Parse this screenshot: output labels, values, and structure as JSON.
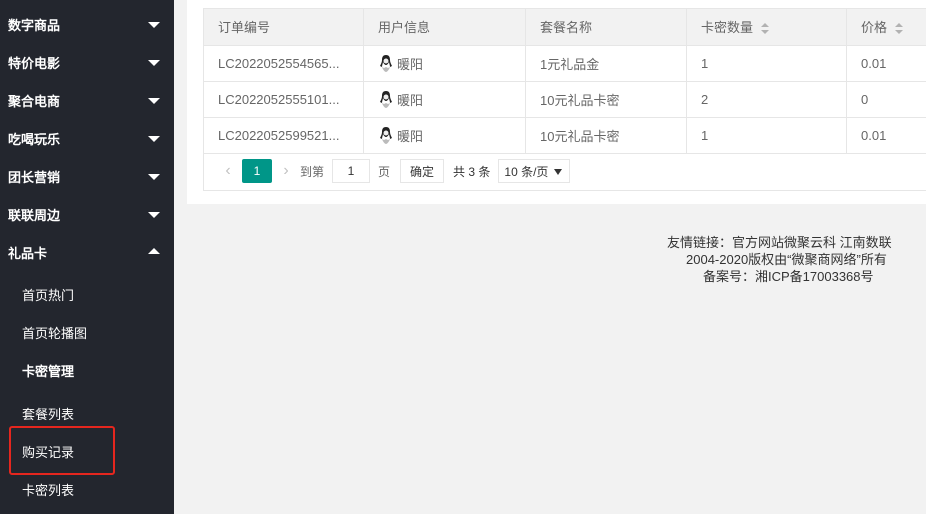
{
  "sidebar": {
    "groups": [
      {
        "label": "数字商品",
        "expanded": false
      },
      {
        "label": "特价电影",
        "expanded": false
      },
      {
        "label": "聚合电商",
        "expanded": false
      },
      {
        "label": "吃喝玩乐",
        "expanded": false
      },
      {
        "label": "团长营销",
        "expanded": false
      },
      {
        "label": "联联周边",
        "expanded": false
      },
      {
        "label": "礼品卡",
        "expanded": true
      }
    ],
    "sub_items": {
      "home_hot": "首页热门",
      "home_carousel": "首页轮播图",
      "card_management": "卡密管理",
      "package_list": "套餐列表",
      "purchase_records": "购买记录",
      "card_list": "卡密列表"
    },
    "colors": {
      "background": "#23262e",
      "highlight": "#e5261e"
    }
  },
  "table": {
    "headers": {
      "order_no": "订单编号",
      "user_info": "用户信息",
      "package_name": "套餐名称",
      "card_quantity": "卡密数量",
      "price": "价格"
    },
    "rows": [
      {
        "order_no": "LC2022052554565...",
        "user": "暖阳",
        "package": "1元礼品金",
        "quantity": "1",
        "price": "0.01"
      },
      {
        "order_no": "LC2022052555101...",
        "user": "暖阳",
        "package": "10元礼品卡密",
        "quantity": "2",
        "price": "0"
      },
      {
        "order_no": "LC2022052599521...",
        "user": "暖阳",
        "package": "10元礼品卡密",
        "quantity": "1",
        "price": "0.01"
      }
    ]
  },
  "pagination": {
    "prev_icon": "chevron-left-icon",
    "current_page": "1",
    "next_icon": "chevron-right-icon",
    "goto_label": "到第",
    "goto_value": "1",
    "page_unit": "页",
    "confirm_label": "确定",
    "total_text": "共 3 条",
    "page_size": "10 条/页",
    "accent": "#009688"
  },
  "footer": {
    "links_label": "友情链接：官方网站微聚云科 江南数联",
    "copyright": "2004-2020版权由“微聚商网络”所有",
    "icp": "备案号：湘ICP备17003368号"
  }
}
